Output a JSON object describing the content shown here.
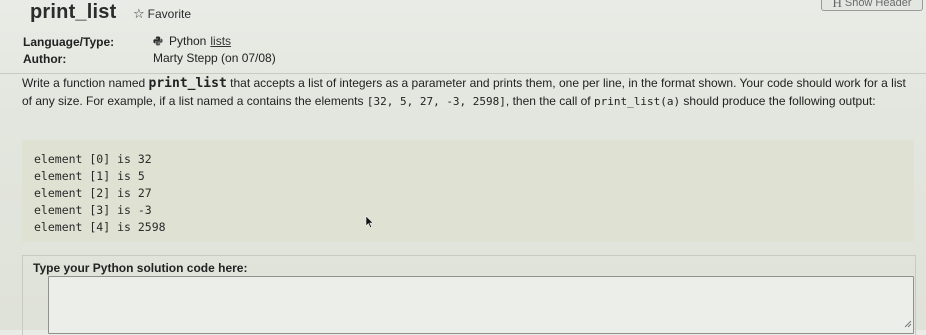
{
  "header": {
    "title": "print_list",
    "favorite_label": "Favorite",
    "show_header_label": "Show Header"
  },
  "meta": {
    "language_label": "Language/Type:",
    "language_value": "Python",
    "language_link": "lists",
    "author_label": "Author:",
    "author_value": "Marty Stepp (on 07/08)"
  },
  "prompt": {
    "p1": "Write a function named ",
    "fn_name": "print_list",
    "p2": " that accepts a list of integers as a parameter and prints them, one per line, in the format shown. Your code should work for a list of any size. For example, if a list named a contains the elements ",
    "example_list": "[32, 5, 27, -3, 2598]",
    "p3": ", then the call of ",
    "example_call": "print_list(a)",
    "p4": " should produce the following output:"
  },
  "output_lines": [
    "element [0] is 32",
    "element [1] is 5",
    "element [2] is 27",
    "element [3] is -3",
    "element [4] is 2598"
  ],
  "solution": {
    "label": "Type your Python solution code here:",
    "value": ""
  },
  "icons": {
    "star": "star-outline-icon",
    "python": "python-icon",
    "cursor": "mouse-pointer-icon",
    "grip": "resize-grip-icon"
  }
}
